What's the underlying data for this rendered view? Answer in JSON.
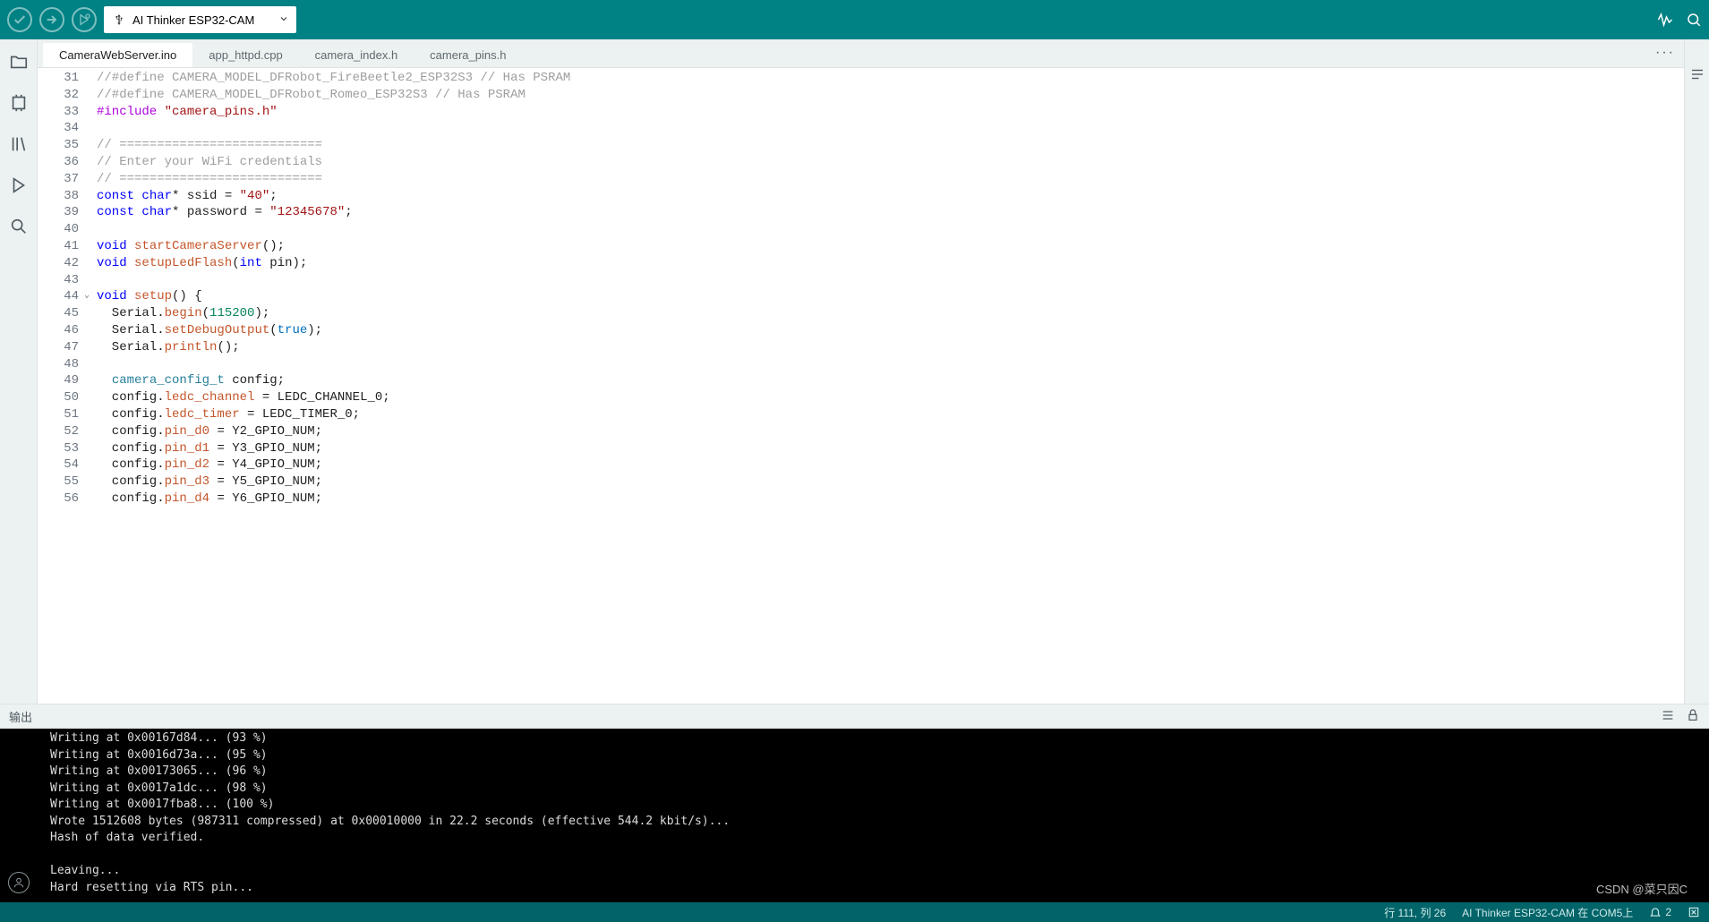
{
  "toolbar": {
    "board_label": "AI Thinker ESP32-CAM"
  },
  "tabs": [
    "CameraWebServer.ino",
    "app_httpd.cpp",
    "camera_index.h",
    "camera_pins.h"
  ],
  "active_tab": 0,
  "code_start_line": 31,
  "code_lines": [
    [
      [
        "c",
        "//#define CAMERA_MODEL_DFRobot_FireBeetle2_ESP32S3 // Has PSRAM"
      ]
    ],
    [
      [
        "c",
        "//#define CAMERA_MODEL_DFRobot_Romeo_ESP32S3 // Has PSRAM"
      ]
    ],
    [
      [
        "pp",
        "#include"
      ],
      [
        "",
        " "
      ],
      [
        "st",
        "\"camera_pins.h\""
      ]
    ],
    [],
    [
      [
        "c",
        "// ==========================="
      ]
    ],
    [
      [
        "c",
        "// Enter your WiFi credentials"
      ]
    ],
    [
      [
        "c",
        "// ==========================="
      ]
    ],
    [
      [
        "kw",
        "const"
      ],
      [
        "",
        " "
      ],
      [
        "kw",
        "char"
      ],
      [
        "br",
        "* "
      ],
      [
        "",
        "ssid = "
      ],
      [
        "st",
        "\"40\""
      ],
      [
        "br",
        ";"
      ]
    ],
    [
      [
        "kw",
        "const"
      ],
      [
        "",
        " "
      ],
      [
        "kw",
        "char"
      ],
      [
        "br",
        "* "
      ],
      [
        "",
        "password = "
      ],
      [
        "st",
        "\"12345678\""
      ],
      [
        "br",
        ";"
      ]
    ],
    [],
    [
      [
        "kw",
        "void"
      ],
      [
        "",
        " "
      ],
      [
        "fn",
        "startCameraServer"
      ],
      [
        "br",
        "();"
      ]
    ],
    [
      [
        "kw",
        "void"
      ],
      [
        "",
        " "
      ],
      [
        "fn",
        "setupLedFlash"
      ],
      [
        "br",
        "("
      ],
      [
        "kw",
        "int"
      ],
      [
        "",
        " pin"
      ],
      [
        "br",
        ");"
      ]
    ],
    [],
    [
      [
        "kw",
        "void"
      ],
      [
        "",
        " "
      ],
      [
        "fn",
        "setup"
      ],
      [
        "br",
        "() {"
      ]
    ],
    [
      [
        "",
        "  Serial."
      ],
      [
        "fn",
        "begin"
      ],
      [
        "br",
        "("
      ],
      [
        "nm",
        "115200"
      ],
      [
        "br",
        ");"
      ]
    ],
    [
      [
        "",
        "  Serial."
      ],
      [
        "fn",
        "setDebugOutput"
      ],
      [
        "br",
        "("
      ],
      [
        "bl",
        "true"
      ],
      [
        "br",
        ");"
      ]
    ],
    [
      [
        "",
        "  Serial."
      ],
      [
        "fn",
        "println"
      ],
      [
        "br",
        "();"
      ]
    ],
    [],
    [
      [
        "",
        "  "
      ],
      [
        "ty",
        "camera_config_t"
      ],
      [
        "",
        " config;"
      ]
    ],
    [
      [
        "",
        "  config."
      ],
      [
        "fn",
        "ledc_channel"
      ],
      [
        "",
        " = LEDC_CHANNEL_0;"
      ]
    ],
    [
      [
        "",
        "  config."
      ],
      [
        "fn",
        "ledc_timer"
      ],
      [
        "",
        " = LEDC_TIMER_0;"
      ]
    ],
    [
      [
        "",
        "  config."
      ],
      [
        "fn",
        "pin_d0"
      ],
      [
        "",
        " = Y2_GPIO_NUM;"
      ]
    ],
    [
      [
        "",
        "  config."
      ],
      [
        "fn",
        "pin_d1"
      ],
      [
        "",
        " = Y3_GPIO_NUM;"
      ]
    ],
    [
      [
        "",
        "  config."
      ],
      [
        "fn",
        "pin_d2"
      ],
      [
        "",
        " = Y4_GPIO_NUM;"
      ]
    ],
    [
      [
        "",
        "  config."
      ],
      [
        "fn",
        "pin_d3"
      ],
      [
        "",
        " = Y5_GPIO_NUM;"
      ]
    ],
    [
      [
        "",
        "  config."
      ],
      [
        "fn",
        "pin_d4"
      ],
      [
        "",
        " = Y6_GPIO_NUM;"
      ]
    ]
  ],
  "fold_line_index": 13,
  "output_title": "输出",
  "output_lines": [
    "Writing at 0x00167d84... (93 %)",
    "Writing at 0x0016d73a... (95 %)",
    "Writing at 0x00173065... (96 %)",
    "Writing at 0x0017a1dc... (98 %)",
    "Writing at 0x0017fba8... (100 %)",
    "Wrote 1512608 bytes (987311 compressed) at 0x00010000 in 22.2 seconds (effective 544.2 kbit/s)...",
    "Hash of data verified.",
    "",
    "Leaving...",
    "Hard resetting via RTS pin..."
  ],
  "statusbar": {
    "cursor": "行 111,  列 26",
    "board": "AI Thinker ESP32-CAM 在 COM5上",
    "notif_count": "2"
  },
  "watermark": "CSDN @菜只因C"
}
